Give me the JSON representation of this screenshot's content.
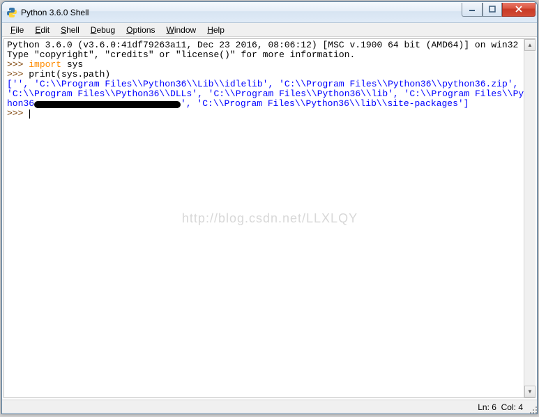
{
  "window": {
    "title": "Python 3.6.0 Shell"
  },
  "menu": {
    "items": [
      "File",
      "Edit",
      "Shell",
      "Debug",
      "Options",
      "Window",
      "Help"
    ]
  },
  "shell": {
    "banner_line1": "Python 3.6.0 (v3.6.0:41df79263a11, Dec 23 2016, 08:06:12) [MSC v.1900 64 bit (AMD64)] on win32",
    "banner_line2": "Type \"copyright\", \"credits\" or \"license()\" for more information.",
    "prompt": ">>> ",
    "cmd1_kw": "import",
    "cmd1_rest": " sys",
    "cmd2": "print(sys.path)",
    "out_pre": "['', '",
    "out_p1": "C:\\\\Program Files\\\\Python36\\\\Lib\\\\idlelib",
    "out_s1": "', '",
    "out_p2": "C:\\\\Program Files\\\\Python36\\\\python36.zip",
    "out_s2": "', '",
    "out_p3": "C:\\\\Program Files\\\\Python36\\\\DLLs",
    "out_s3": "', '",
    "out_p4": "C:\\\\Program Files\\\\Python36\\\\lib",
    "out_s4": "', '",
    "out_p5": "C:\\\\Program Files\\\\Python36",
    "out_s5": "', '",
    "out_p6": "C:\\\\Program Files\\\\Python36\\\\lib\\\\site-packages",
    "out_post": "']"
  },
  "watermark": "http://blog.csdn.net/LLXLQY",
  "status": {
    "ln_label": "Ln:",
    "ln_value": "6",
    "col_label": "Col:",
    "col_value": "4"
  }
}
